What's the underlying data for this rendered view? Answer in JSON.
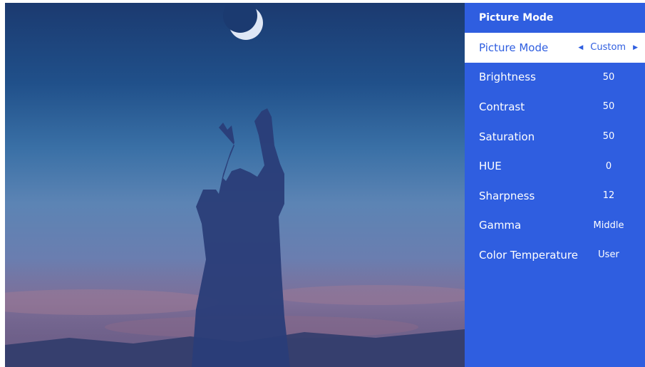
{
  "panel": {
    "title": "Picture Mode",
    "items": [
      {
        "label": "Picture Mode",
        "value": "Custom",
        "selected": true
      },
      {
        "label": "Brightness",
        "value": "50"
      },
      {
        "label": "Contrast",
        "value": "50"
      },
      {
        "label": "Saturation",
        "value": "50"
      },
      {
        "label": "HUE",
        "value": "0"
      },
      {
        "label": "Sharpness",
        "value": "12"
      },
      {
        "label": "Gamma",
        "value": "Middle"
      },
      {
        "label": "Color Temperature",
        "value": "User"
      }
    ]
  },
  "icons": {
    "left_arrow": "caret-left-icon",
    "right_arrow": "caret-right-icon"
  },
  "colors": {
    "panel_background": "#2f5ee0",
    "selected_background": "#ffffff",
    "selected_text": "#2f5ee0"
  }
}
